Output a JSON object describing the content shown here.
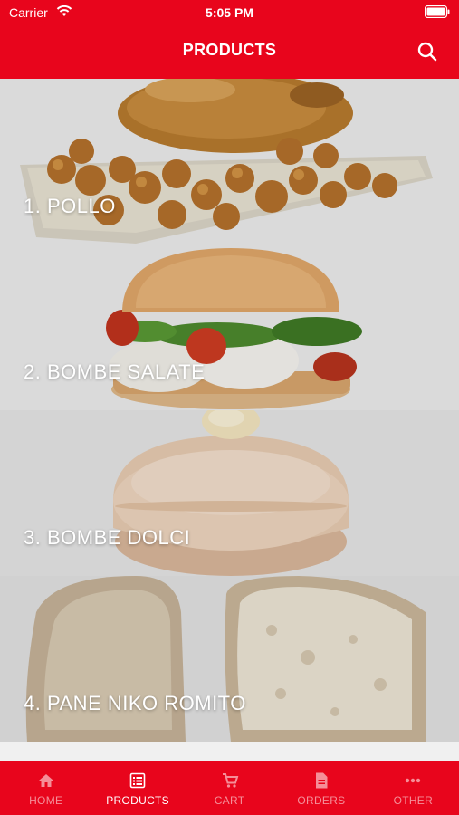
{
  "status_bar": {
    "carrier": "Carrier",
    "time": "5:05 PM"
  },
  "header": {
    "title": "PRODUCTS"
  },
  "products": [
    {
      "label": "1. POLLO"
    },
    {
      "label": "2. BOMBE SALATE"
    },
    {
      "label": "3. BOMBE DOLCI"
    },
    {
      "label": "4. PANE NIKO ROMITO"
    }
  ],
  "tabs": [
    {
      "label": "HOME",
      "icon": "home-icon",
      "active": false
    },
    {
      "label": "PRODUCTS",
      "icon": "list-icon",
      "active": true
    },
    {
      "label": "CART",
      "icon": "cart-icon",
      "active": false
    },
    {
      "label": "ORDERS",
      "icon": "document-icon",
      "active": false
    },
    {
      "label": "OTHER",
      "icon": "more-icon",
      "active": false
    }
  ],
  "colors": {
    "brand": "#e8051c",
    "tab_inactive": "#f39aa3",
    "tab_active": "#ffffff"
  }
}
